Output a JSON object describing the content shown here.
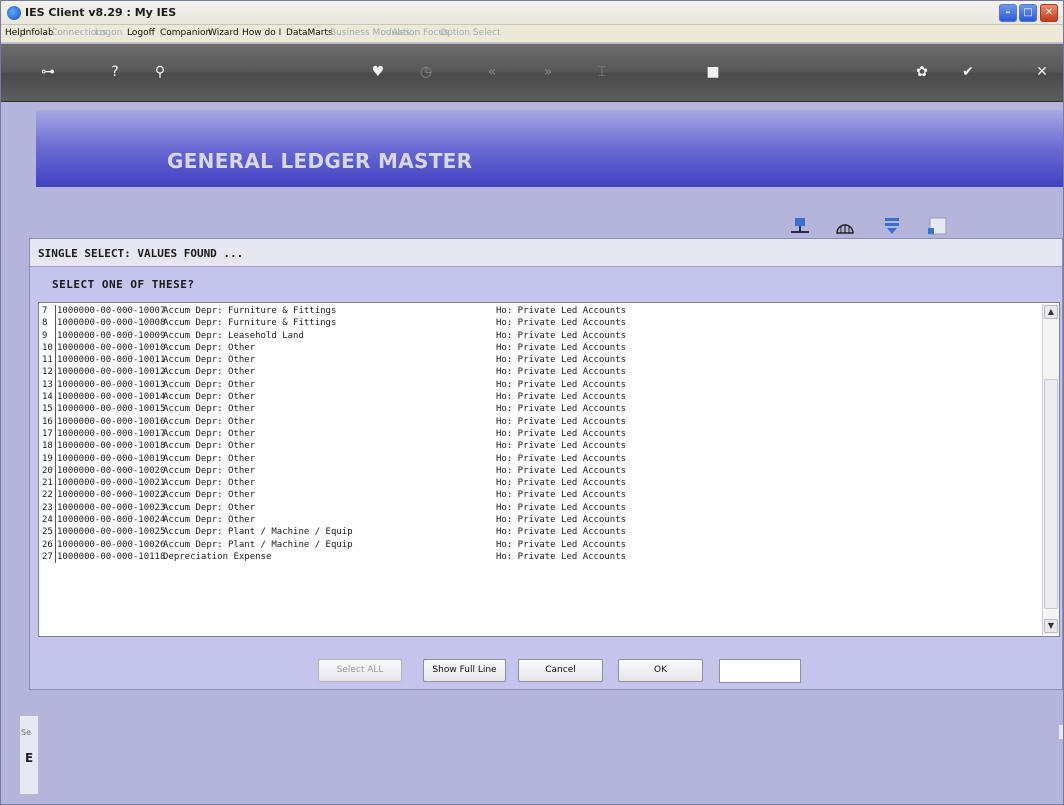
{
  "window": {
    "title": "IES Client v8.29 : My IES"
  },
  "menu": [
    {
      "label": "Help",
      "enabled": true
    },
    {
      "label": "Infolab",
      "enabled": true
    },
    {
      "label": "Connections",
      "enabled": false
    },
    {
      "label": "Logon",
      "enabled": false
    },
    {
      "label": "Logoff",
      "enabled": true
    },
    {
      "label": "Companion",
      "enabled": true
    },
    {
      "label": "Wizard",
      "enabled": true
    },
    {
      "label": "How do I",
      "enabled": true
    },
    {
      "label": "DataMarts",
      "enabled": true
    },
    {
      "label": "Business Modules",
      "enabled": false
    },
    {
      "label": "Action Focus",
      "enabled": false
    },
    {
      "label": "Option Select",
      "enabled": false
    }
  ],
  "toolbar": {
    "icons": [
      {
        "name": "key-icon",
        "glyph": "⊶",
        "enabled": true
      },
      {
        "name": "help-icon",
        "glyph": "?",
        "enabled": true
      },
      {
        "name": "search-icon",
        "glyph": "⚲",
        "enabled": true
      },
      {
        "name": "heart-icon",
        "glyph": "♥",
        "enabled": true
      },
      {
        "name": "clock-icon",
        "glyph": "◷",
        "enabled": false
      },
      {
        "name": "back-icon",
        "glyph": "«",
        "enabled": false
      },
      {
        "name": "forward-icon",
        "glyph": "»",
        "enabled": false
      },
      {
        "name": "marker-icon",
        "glyph": "⌶",
        "enabled": false
      },
      {
        "name": "stop-icon",
        "glyph": "■",
        "enabled": true
      },
      {
        "name": "refresh-icon",
        "glyph": "✿",
        "enabled": true
      },
      {
        "name": "check-icon",
        "glyph": "✔",
        "enabled": true
      },
      {
        "name": "close-icon",
        "glyph": "✕",
        "enabled": true
      }
    ]
  },
  "header": {
    "title": "GENERAL LEDGER MASTER"
  },
  "header_icons": [
    "network-icon",
    "globe-icon",
    "download-icon",
    "window-icon"
  ],
  "dialog": {
    "title": "SINGLE SELECT: VALUES FOUND ...",
    "prompt": "SELECT ONE OF THESE?",
    "rows": [
      {
        "num": "7",
        "code": "1000000-00-000-10007",
        "desc": "Accum Depr: Furniture & Fittings",
        "group": "Ho: Private Led Accounts"
      },
      {
        "num": "8",
        "code": "1000000-00-000-10008",
        "desc": "Accum Depr: Furniture & Fittings",
        "group": "Ho: Private Led Accounts"
      },
      {
        "num": "9",
        "code": "1000000-00-000-10009",
        "desc": "Accum Depr: Leasehold Land",
        "group": "Ho: Private Led Accounts"
      },
      {
        "num": "10",
        "code": "1000000-00-000-10010",
        "desc": "Accum Depr: Other",
        "group": "Ho: Private Led Accounts"
      },
      {
        "num": "11",
        "code": "1000000-00-000-10011",
        "desc": "Accum Depr: Other",
        "group": "Ho: Private Led Accounts"
      },
      {
        "num": "12",
        "code": "1000000-00-000-10012",
        "desc": "Accum Depr: Other",
        "group": "Ho: Private Led Accounts"
      },
      {
        "num": "13",
        "code": "1000000-00-000-10013",
        "desc": "Accum Depr: Other",
        "group": "Ho: Private Led Accounts"
      },
      {
        "num": "14",
        "code": "1000000-00-000-10014",
        "desc": "Accum Depr: Other",
        "group": "Ho: Private Led Accounts"
      },
      {
        "num": "15",
        "code": "1000000-00-000-10015",
        "desc": "Accum Depr: Other",
        "group": "Ho: Private Led Accounts"
      },
      {
        "num": "16",
        "code": "1000000-00-000-10016",
        "desc": "Accum Depr: Other",
        "group": "Ho: Private Led Accounts"
      },
      {
        "num": "17",
        "code": "1000000-00-000-10017",
        "desc": "Accum Depr: Other",
        "group": "Ho: Private Led Accounts"
      },
      {
        "num": "18",
        "code": "1000000-00-000-10018",
        "desc": "Accum Depr: Other",
        "group": "Ho: Private Led Accounts"
      },
      {
        "num": "19",
        "code": "1000000-00-000-10019",
        "desc": "Accum Depr: Other",
        "group": "Ho: Private Led Accounts"
      },
      {
        "num": "20",
        "code": "1000000-00-000-10020",
        "desc": "Accum Depr: Other",
        "group": "Ho: Private Led Accounts"
      },
      {
        "num": "21",
        "code": "1000000-00-000-10021",
        "desc": "Accum Depr: Other",
        "group": "Ho: Private Led Accounts"
      },
      {
        "num": "22",
        "code": "1000000-00-000-10022",
        "desc": "Accum Depr: Other",
        "group": "Ho: Private Led Accounts"
      },
      {
        "num": "23",
        "code": "1000000-00-000-10023",
        "desc": "Accum Depr: Other",
        "group": "Ho: Private Led Accounts"
      },
      {
        "num": "24",
        "code": "1000000-00-000-10024",
        "desc": "Accum Depr: Other",
        "group": "Ho: Private Led Accounts"
      },
      {
        "num": "25",
        "code": "1000000-00-000-10025",
        "desc": "Accum Depr: Plant / Machine / Equip",
        "group": "Ho: Private Led Accounts"
      },
      {
        "num": "26",
        "code": "1000000-00-000-10026",
        "desc": "Accum Depr: Plant / Machine / Equip",
        "group": "Ho: Private Led Accounts"
      },
      {
        "num": "27",
        "code": "1000000-00-000-10118",
        "desc": "Depreciation Expense",
        "group": "Ho: Private Led Accounts"
      }
    ],
    "buttons": {
      "select_all": "Select ALL",
      "show_full_line": "Show Full Line",
      "cancel": "Cancel",
      "ok": "OK"
    },
    "filter_value": ""
  },
  "bottom": {
    "label": "Se",
    "char": "E"
  }
}
